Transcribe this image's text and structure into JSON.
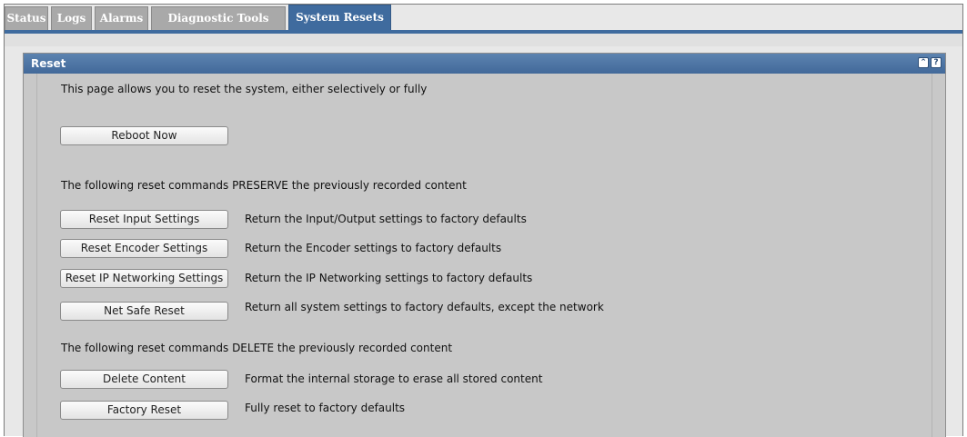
{
  "tabs": [
    {
      "label": "Status"
    },
    {
      "label": "Logs"
    },
    {
      "label": "Alarms"
    },
    {
      "label": "Diagnostic Tools"
    },
    {
      "label": "System Resets"
    }
  ],
  "panel": {
    "title": "Reset",
    "collapse_icon": "double-chevron-up-icon",
    "help_icon": "help-icon",
    "collapse_glyph": "⌃",
    "help_glyph": "?"
  },
  "intro": "This page allows you to reset the system, either selectively or fully",
  "reboot_label": "Reboot Now",
  "preserve_heading": "The following reset commands PRESERVE the previously recorded content",
  "preserve_actions": [
    {
      "label": "Reset Input Settings",
      "description": "Return the Input/Output settings to factory defaults"
    },
    {
      "label": "Reset Encoder Settings",
      "description": "Return the Encoder settings to factory defaults"
    },
    {
      "label": "Reset IP Networking Settings",
      "description": "Return the IP Networking settings to factory defaults"
    },
    {
      "label": "Net Safe Reset",
      "description": "Return all system settings to factory defaults, except the network"
    }
  ],
  "delete_heading": "The following reset commands DELETE the previously recorded content",
  "delete_actions": [
    {
      "label": "Delete Content",
      "description": "Format the internal storage to erase all stored content"
    },
    {
      "label": "Factory Reset",
      "description": "Fully reset to factory defaults"
    }
  ],
  "colors": {
    "accent": "#3f6b9e",
    "tab_inactive": "#a9a9a9",
    "panel_bg": "#c8c8c8"
  }
}
